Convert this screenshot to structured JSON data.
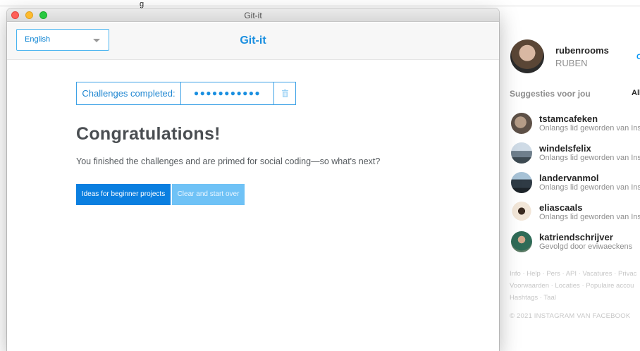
{
  "background": {
    "top_crumb": "g",
    "profile": {
      "username": "rubenrooms",
      "fullname": "RUBEN",
      "switch_label": "C"
    },
    "suggestions_header": "Suggesties voor jou",
    "suggestions_all": "All",
    "suggestions": [
      {
        "name": "tstamcafeken",
        "sub": "Onlangs lid geworden van Ins"
      },
      {
        "name": "windelsfelix",
        "sub": "Onlangs lid geworden van Ins"
      },
      {
        "name": "landervanmol",
        "sub": "Onlangs lid geworden van Ins"
      },
      {
        "name": "eliascaals",
        "sub": "Onlangs lid geworden van Ins"
      },
      {
        "name": "katriendschrijver",
        "sub": "Gevolgd door eviwaeckens"
      }
    ],
    "footer_lines": [
      "Info · Help · Pers · API · Vacatures · Privac",
      "Voorwaarden · Locaties · Populaire accou",
      "Hashtags · Taal"
    ],
    "copyright": "© 2021 INSTAGRAM VAN FACEBOOK"
  },
  "window": {
    "title": "Git-it"
  },
  "app": {
    "title": "Git-it",
    "language": "English",
    "challenges_label": "Challenges completed:",
    "challenges_completed": 11,
    "challenges_dots": "●●●●●●●●●●●",
    "heading": "Congratulations!",
    "message": "You finished the challenges and are primed for social coding—so what's next?",
    "btn_ideas": "Ideas for beginner projects",
    "btn_clear": "Clear and start over"
  },
  "colors": {
    "accent": "#1a8fe0",
    "primary_button": "#0b7fe0",
    "secondary_button": "#6fc2f6",
    "instagram_blue": "#0095f6"
  }
}
